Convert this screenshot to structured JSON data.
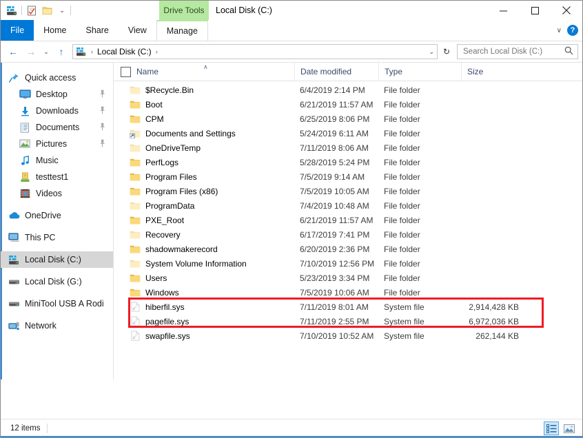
{
  "window": {
    "title": "Local Disk (C:)",
    "contextual_tab": "Drive Tools",
    "minimize": "—",
    "maximize": "☐",
    "close": "✕",
    "help": "?",
    "ribbon_collapse": "∨"
  },
  "quick_access_toolbar": {
    "items": [
      {
        "name": "drive-icon",
        "label": "Local Disk (C:)"
      },
      {
        "name": "properties-icon",
        "label": "Properties"
      },
      {
        "name": "new-folder-icon",
        "label": "New folder"
      }
    ],
    "dropdown": "⌄"
  },
  "ribbon": {
    "tabs": [
      {
        "label": "File",
        "active": true
      },
      {
        "label": "Home",
        "active": false
      },
      {
        "label": "Share",
        "active": false
      },
      {
        "label": "View",
        "active": false
      },
      {
        "label": "Manage",
        "active": false,
        "contextual": true
      }
    ]
  },
  "addressbar": {
    "back": "←",
    "forward": "→",
    "recent": "⌄",
    "up": "↑",
    "breadcrumb": [
      "Local Disk (C:)"
    ],
    "breadcrumb_separator": "›",
    "dropdown": "⌄",
    "refresh": "↻"
  },
  "search": {
    "placeholder": "Search Local Disk (C:)",
    "value": "",
    "icon": "⌕"
  },
  "sidebar": {
    "items": [
      {
        "label": "Quick access",
        "icon": "star-pin-icon",
        "indent": false,
        "pinned": false,
        "selected": false
      },
      {
        "label": "Desktop",
        "icon": "desktop-icon",
        "indent": true,
        "pinned": true,
        "selected": false
      },
      {
        "label": "Downloads",
        "icon": "downloads-icon",
        "indent": true,
        "pinned": true,
        "selected": false
      },
      {
        "label": "Documents",
        "icon": "documents-icon",
        "indent": true,
        "pinned": true,
        "selected": false
      },
      {
        "label": "Pictures",
        "icon": "pictures-icon",
        "indent": true,
        "pinned": true,
        "selected": false
      },
      {
        "label": "Music",
        "icon": "music-icon",
        "indent": true,
        "pinned": false,
        "selected": false
      },
      {
        "label": "testtest1",
        "icon": "folder-user-icon",
        "indent": true,
        "pinned": false,
        "selected": false
      },
      {
        "label": "Videos",
        "icon": "videos-icon",
        "indent": true,
        "pinned": false,
        "selected": false
      },
      {
        "label": "OneDrive",
        "icon": "onedrive-cloud-icon",
        "indent": false,
        "pinned": false,
        "selected": false
      },
      {
        "label": "This PC",
        "icon": "this-pc-icon",
        "indent": false,
        "pinned": false,
        "selected": false
      },
      {
        "label": "Local Disk (C:)",
        "icon": "system-drive-icon",
        "indent": false,
        "pinned": false,
        "selected": true
      },
      {
        "label": "Local Disk (G:)",
        "icon": "drive-icon",
        "indent": false,
        "pinned": false,
        "selected": false
      },
      {
        "label": "MiniTool USB A Rodi",
        "icon": "drive-icon",
        "indent": false,
        "pinned": false,
        "selected": false
      },
      {
        "label": "Network",
        "icon": "network-icon",
        "indent": false,
        "pinned": false,
        "selected": false
      }
    ],
    "pin_glyph": "📌"
  },
  "filelist": {
    "columns": [
      {
        "label": "Name",
        "sorted": "ascending",
        "sort_glyph": "∧"
      },
      {
        "label": "Date modified",
        "sorted": ""
      },
      {
        "label": "Type",
        "sorted": ""
      },
      {
        "label": "Size",
        "sorted": ""
      }
    ],
    "rows": [
      {
        "name": "$Recycle.Bin",
        "date": "6/4/2019 2:14 PM",
        "type": "File folder",
        "size": "",
        "icon": "folder-hidden-icon"
      },
      {
        "name": "Boot",
        "date": "6/21/2019 11:57 AM",
        "type": "File folder",
        "size": "",
        "icon": "folder-icon"
      },
      {
        "name": "CPM",
        "date": "6/25/2019 8:06 PM",
        "type": "File folder",
        "size": "",
        "icon": "folder-icon"
      },
      {
        "name": "Documents and Settings",
        "date": "5/24/2019 6:11 AM",
        "type": "File folder",
        "size": "",
        "icon": "folder-junction-icon"
      },
      {
        "name": "OneDriveTemp",
        "date": "7/11/2019 8:06 AM",
        "type": "File folder",
        "size": "",
        "icon": "folder-hidden-icon"
      },
      {
        "name": "PerfLogs",
        "date": "5/28/2019 5:24 PM",
        "type": "File folder",
        "size": "",
        "icon": "folder-icon"
      },
      {
        "name": "Program Files",
        "date": "7/5/2019 9:14 AM",
        "type": "File folder",
        "size": "",
        "icon": "folder-icon"
      },
      {
        "name": "Program Files (x86)",
        "date": "7/5/2019 10:05 AM",
        "type": "File folder",
        "size": "",
        "icon": "folder-icon"
      },
      {
        "name": "ProgramData",
        "date": "7/4/2019 10:48 AM",
        "type": "File folder",
        "size": "",
        "icon": "folder-hidden-icon"
      },
      {
        "name": "PXE_Root",
        "date": "6/21/2019 11:57 AM",
        "type": "File folder",
        "size": "",
        "icon": "folder-icon"
      },
      {
        "name": "Recovery",
        "date": "6/17/2019 7:41 PM",
        "type": "File folder",
        "size": "",
        "icon": "folder-hidden-icon"
      },
      {
        "name": "shadowmakerecord",
        "date": "6/20/2019 2:36 PM",
        "type": "File folder",
        "size": "",
        "icon": "folder-icon"
      },
      {
        "name": "System Volume Information",
        "date": "7/10/2019 12:56 PM",
        "type": "File folder",
        "size": "",
        "icon": "folder-hidden-icon"
      },
      {
        "name": "Users",
        "date": "5/23/2019 3:34 PM",
        "type": "File folder",
        "size": "",
        "icon": "folder-icon"
      },
      {
        "name": "Windows",
        "date": "7/5/2019 10:06 AM",
        "type": "File folder",
        "size": "",
        "icon": "folder-icon"
      },
      {
        "name": "hiberfil.sys",
        "date": "7/11/2019 8:01 AM",
        "type": "System file",
        "size": "2,914,428 KB",
        "icon": "system-file-icon"
      },
      {
        "name": "pagefile.sys",
        "date": "7/11/2019 2:55 PM",
        "type": "System file",
        "size": "6,972,036 KB",
        "icon": "system-file-icon"
      },
      {
        "name": "swapfile.sys",
        "date": "7/10/2019 10:52 AM",
        "type": "System file",
        "size": "262,144 KB",
        "icon": "system-file-icon"
      }
    ],
    "annotation": {
      "color": "#ee1c25",
      "covers": [
        "hiberfil.sys",
        "pagefile.sys"
      ]
    }
  },
  "statusbar": {
    "item_count": "12 items",
    "views": [
      {
        "name": "details-view-button",
        "active": true
      },
      {
        "name": "large-icons-view-button",
        "active": false
      }
    ]
  }
}
